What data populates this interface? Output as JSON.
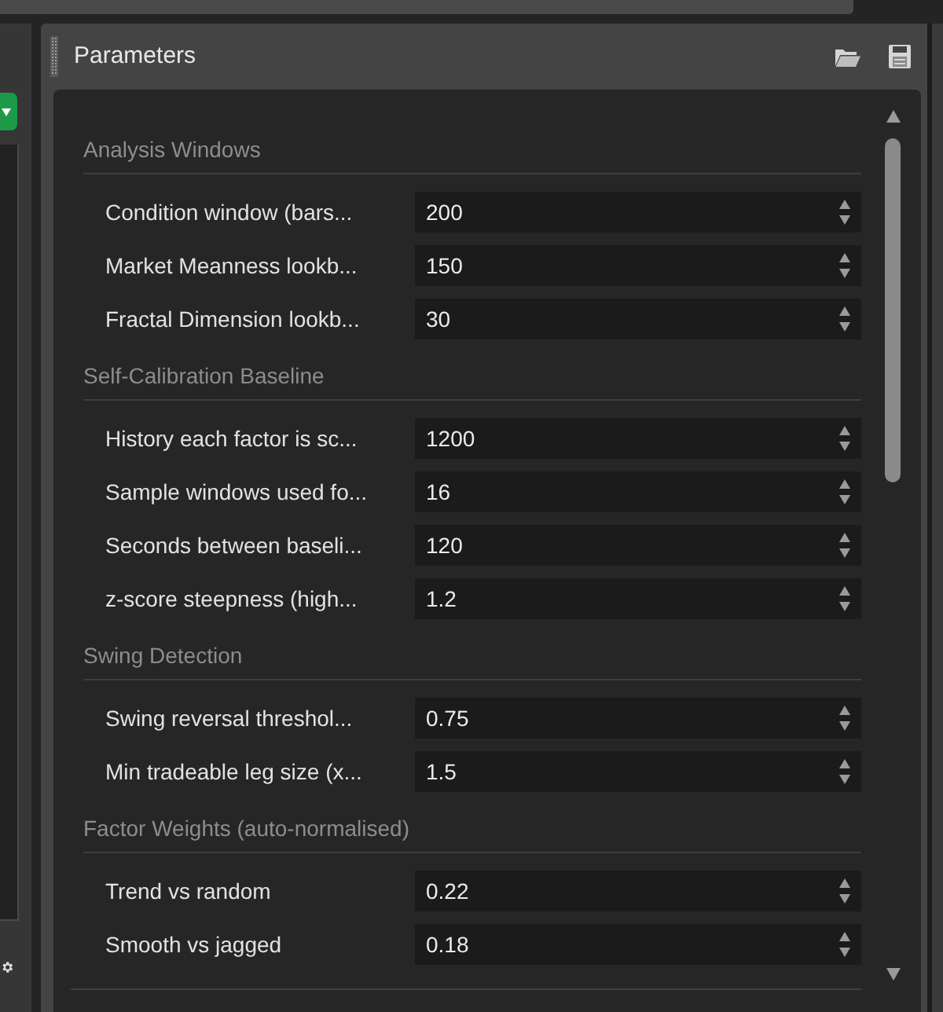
{
  "panel": {
    "title": "Parameters"
  },
  "sections": [
    {
      "heading": "Analysis Windows",
      "fields": [
        {
          "label": "Condition window (bars...",
          "value": "200"
        },
        {
          "label": "Market Meanness lookb...",
          "value": "150"
        },
        {
          "label": "Fractal Dimension lookb...",
          "value": "30"
        }
      ]
    },
    {
      "heading": "Self-Calibration Baseline",
      "fields": [
        {
          "label": "History each factor is sc...",
          "value": "1200"
        },
        {
          "label": "Sample windows used fo...",
          "value": "16"
        },
        {
          "label": "Seconds between baseli...",
          "value": "120"
        },
        {
          "label": "z-score steepness (high...",
          "value": "1.2"
        }
      ]
    },
    {
      "heading": "Swing Detection",
      "fields": [
        {
          "label": "Swing reversal threshol...",
          "value": "0.75"
        },
        {
          "label": "Min tradeable leg size (x...",
          "value": "1.5"
        }
      ]
    },
    {
      "heading": "Factor Weights (auto-normalised)",
      "fields": [
        {
          "label": "Trend vs random",
          "value": "0.22"
        },
        {
          "label": "Smooth vs jagged",
          "value": "0.18"
        }
      ]
    }
  ]
}
